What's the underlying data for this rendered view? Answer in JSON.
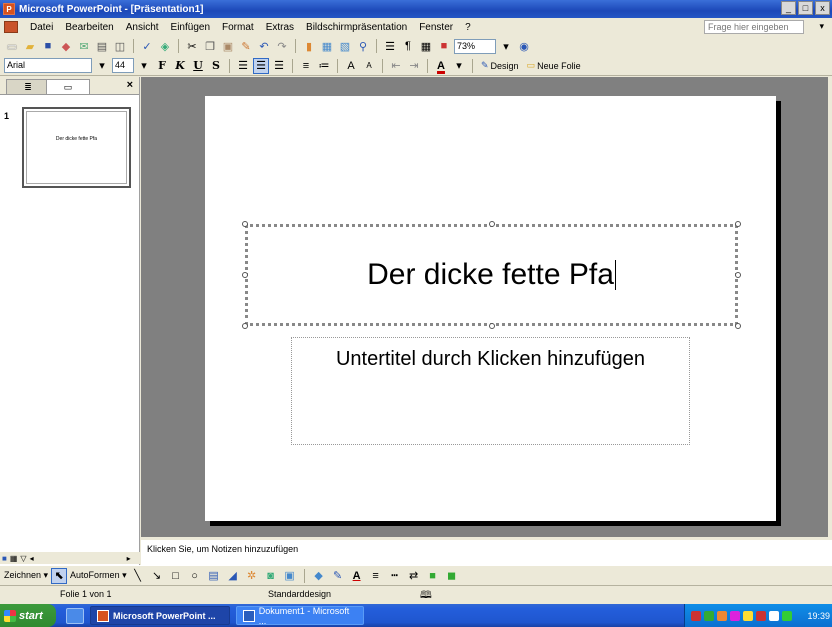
{
  "window": {
    "title": "Microsoft PowerPoint - [Präsentation1]",
    "buttons": [
      "_",
      "□",
      "x"
    ]
  },
  "menu": {
    "items": [
      "Datei",
      "Bearbeiten",
      "Ansicht",
      "Einfügen",
      "Format",
      "Extras",
      "Bildschirmpräsentation",
      "Fenster",
      "?"
    ],
    "help_placeholder": "Frage hier eingeben"
  },
  "standard_toolbar": {
    "zoom": "73%"
  },
  "format_toolbar": {
    "font": "Arial",
    "size": "44",
    "bold": "F",
    "italic": "K",
    "underline": "U",
    "shadow": "S",
    "design_label": "Design",
    "new_slide_label": "Neue Folie"
  },
  "left_pane": {
    "tab_outline": "≣",
    "tab_slides": "▭",
    "close": "×",
    "slide_number": "1",
    "thumb_title": "Der dicke fette Pfa"
  },
  "slide": {
    "title": "Der dicke fette Pfa",
    "subtitle_placeholder": "Untertitel durch Klicken hinzufügen"
  },
  "notes": {
    "placeholder": "Klicken Sie, um Notizen hinzuzufügen"
  },
  "draw_toolbar": {
    "draw_label": "Zeichnen ▾",
    "autoshapes_label": "AutoFormen ▾"
  },
  "status": {
    "slide_info": "Folie 1 von 1",
    "design": "Standarddesign"
  },
  "taskbar": {
    "start": "start",
    "task_active": "Microsoft PowerPoint ...",
    "task_word": "Dokument1 - Microsoft ...",
    "clock": "19:39"
  }
}
